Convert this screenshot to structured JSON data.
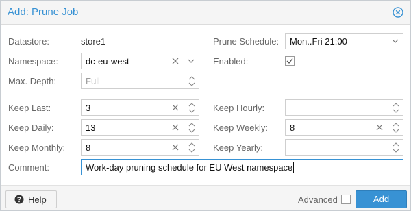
{
  "dialog": {
    "title": "Add: Prune Job",
    "close_icon": "close-circle-icon"
  },
  "form": {
    "datastore": {
      "label": "Datastore:",
      "value": "store1"
    },
    "prune_schedule": {
      "label": "Prune Schedule:",
      "value": "Mon..Fri 21:00"
    },
    "namespace": {
      "label": "Namespace:",
      "value": "dc-eu-west"
    },
    "enabled": {
      "label": "Enabled:",
      "checked": true
    },
    "max_depth": {
      "label": "Max. Depth:",
      "placeholder": "Full",
      "value": ""
    },
    "keep_last": {
      "label": "Keep Last:",
      "value": "3"
    },
    "keep_hourly": {
      "label": "Keep Hourly:",
      "value": ""
    },
    "keep_daily": {
      "label": "Keep Daily:",
      "value": "13"
    },
    "keep_weekly": {
      "label": "Keep Weekly:",
      "value": "8"
    },
    "keep_monthly": {
      "label": "Keep Monthly:",
      "value": "8"
    },
    "keep_yearly": {
      "label": "Keep Yearly:",
      "value": ""
    },
    "comment": {
      "label": "Comment:",
      "value": "Work-day pruning schedule for EU West namespace"
    }
  },
  "footer": {
    "help_label": "Help",
    "advanced_label": "Advanced",
    "advanced_checked": false,
    "add_label": "Add"
  },
  "colors": {
    "accent": "#3892d4",
    "label": "#666666",
    "border": "#cfcfcf"
  }
}
